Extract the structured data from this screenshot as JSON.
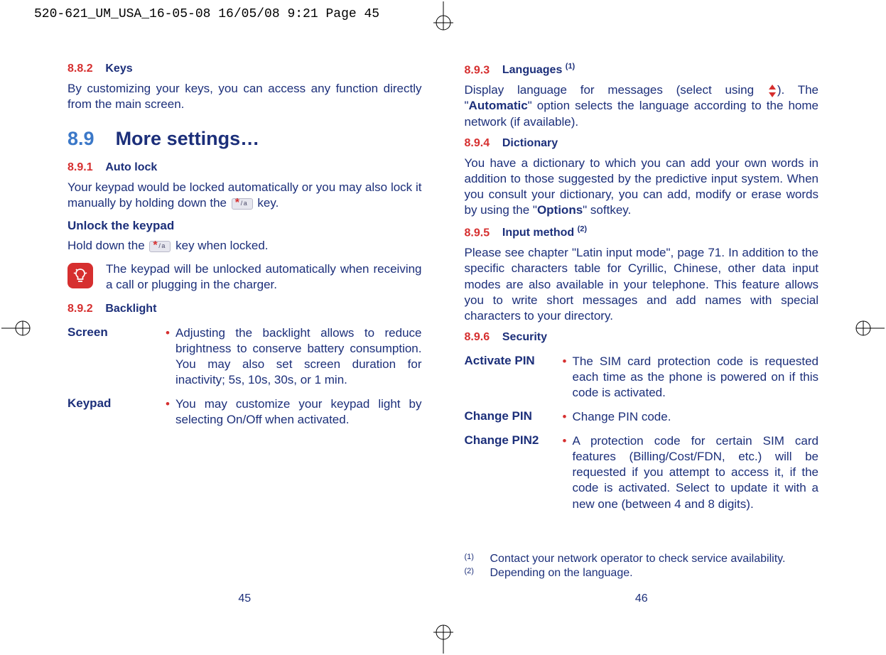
{
  "header": "520-621_UM_USA_16-05-08  16/05/08  9:21  Page 45",
  "left": {
    "s882_num": "8.8.2",
    "s882_title": "Keys",
    "s882_body": "By customizing your keys, you can access any function directly from the main screen.",
    "s89_num": "8.9",
    "s89_title": "More settings…",
    "s891_num": "8.9.1",
    "s891_title": "Auto lock",
    "s891_body_a": "Your keypad would be locked automatically or you may also lock it manually by holding down the ",
    "s891_body_b": " key.",
    "unlock_label": "Unlock the keypad",
    "unlock_body_a": "Hold down the ",
    "unlock_body_b": " key when locked.",
    "note": "The keypad will be unlocked automatically when receiving a call or plugging in the charger.",
    "s892_num": "8.9.2",
    "s892_title": "Backlight",
    "screen_term": "Screen",
    "screen_def": "Adjusting the backlight allows to reduce brightness to conserve battery consumption. You may also set screen duration for inactivity; 5s, 10s, 30s, or 1 min.",
    "keypad_term": "Keypad",
    "keypad_def": "You may customize your keypad light by selecting On/Off when activated.",
    "page_num": "45"
  },
  "right": {
    "s893_num": "8.9.3",
    "s893_title_a": "Languages ",
    "s893_sup": "(1)",
    "s893_body_a": "Display language for messages (select using ",
    "s893_body_b": "). The \"",
    "s893_auto": "Automatic",
    "s893_body_c": "\" option selects the language according to the home network (if available).",
    "s894_num": "8.9.4",
    "s894_title": "Dictionary",
    "s894_body_a": "You have a dictionary to which you can add your own words in addition to those suggested by the predictive input system. When you consult your dictionary, you can add, modify or erase words by using the \"",
    "s894_options": "Options",
    "s894_body_b": "\" softkey.",
    "s895_num": "8.9.5",
    "s895_title_a": "Input method ",
    "s895_sup": "(2)",
    "s895_body": "Please see chapter \"Latin input mode\", page 71. In addition to the specific characters table for Cyrillic, Chinese, other data input modes are also available in your telephone. This feature allows you to write short messages and add names with special characters to your directory.",
    "s896_num": "8.9.6",
    "s896_title": "Security",
    "activate_term": "Activate PIN",
    "activate_def": "The SIM card protection code is requested each time as the phone is powered on if this code is activated.",
    "changepin_term": "Change PIN",
    "changepin_def": "Change PIN code.",
    "changepin2_term": "Change PIN2",
    "changepin2_def": "A protection code for certain SIM card features (Billing/Cost/FDN, etc.) will be requested if you attempt to access it, if the code is activated. Select to update it with a new one (between 4 and 8 digits).",
    "fn1_mark": "(1)",
    "fn1_text": "Contact your network operator to check service availability.",
    "fn2_mark": "(2)",
    "fn2_text": "Depending on the language.",
    "page_num": "46"
  }
}
